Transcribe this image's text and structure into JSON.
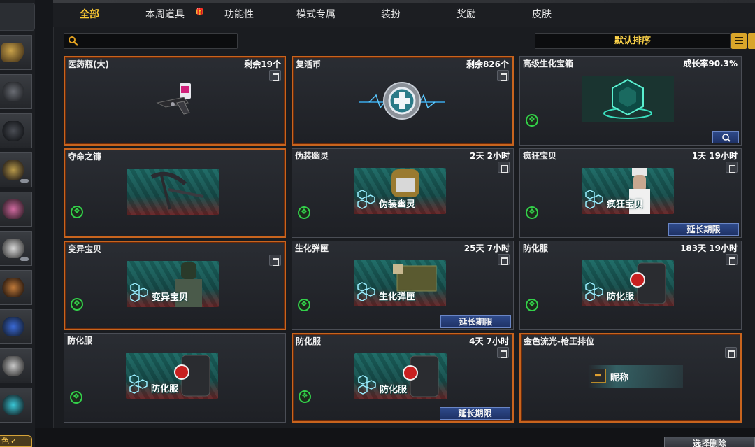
{
  "tabs": [
    {
      "label": "全部",
      "active": true
    },
    {
      "label": "本周道具",
      "gift_icon": "gift-icon"
    },
    {
      "label": "功能性"
    },
    {
      "label": "模式专属"
    },
    {
      "label": "装扮"
    },
    {
      "label": "奖励"
    },
    {
      "label": "皮肤"
    }
  ],
  "search": {
    "placeholder": "",
    "value": "",
    "icon": "search-icon"
  },
  "sort": {
    "label": "默认排序"
  },
  "cards": [
    {
      "name": "医药瓶(大)",
      "meta": "剩余19个",
      "art": "gun-icon",
      "trash": true,
      "selected": true
    },
    {
      "name": "复活币",
      "meta": "剩余826个",
      "art": "cross-coin-icon",
      "trash": true,
      "selected": true
    },
    {
      "name": "高级生化宝箱",
      "meta": "成长率90.3%",
      "art": "chest-icon",
      "bio": true,
      "zoom": true,
      "selected": false
    },
    {
      "name": "夺命之镰",
      "meta": "",
      "art_label": "",
      "art": "scythe-icon",
      "bio": true,
      "selected": true
    },
    {
      "name": "伪装幽灵",
      "meta": "2天 2小时",
      "art_label": "伪装幽灵",
      "bio": true,
      "trash": true,
      "selected": false
    },
    {
      "name": "疯狂宝贝",
      "meta": "1天 19小时",
      "art_label": "疯狂宝贝",
      "bio": true,
      "trash": true,
      "extend": "延长期限",
      "selected": false
    },
    {
      "name": "变异宝贝",
      "meta": "",
      "art_label": "变异宝贝",
      "bio": true,
      "trash": true,
      "selected": true
    },
    {
      "name": "生化弹匣",
      "meta": "25天 7小时",
      "art_label": "生化弹匣",
      "bio": true,
      "trash": true,
      "extend": "延长期限",
      "selected": false
    },
    {
      "name": "防化服",
      "meta": "183天 19小时",
      "art_label": "防化服",
      "bio": true,
      "trash": true,
      "selected": false
    },
    {
      "name": "防化服",
      "meta": "",
      "art_label": "防化服",
      "bio": true,
      "selected": false
    },
    {
      "name": "防化服",
      "meta": "4天 7小时",
      "art_label": "防化服",
      "bio": true,
      "trash": true,
      "extend": "延长期限",
      "selected": true
    },
    {
      "name": "金色流光-枪王排位",
      "meta": "",
      "nickname": "昵称",
      "trash": true,
      "selected": true
    }
  ],
  "bottom": {
    "select_delete": "选择删除",
    "left_label": "色",
    "left_check": "✓"
  },
  "colors": {
    "accent": "#ffcc33",
    "selected_border": "#c8641e",
    "teal_art": "#1d6b66",
    "button_blue": "#2f4a8a"
  }
}
